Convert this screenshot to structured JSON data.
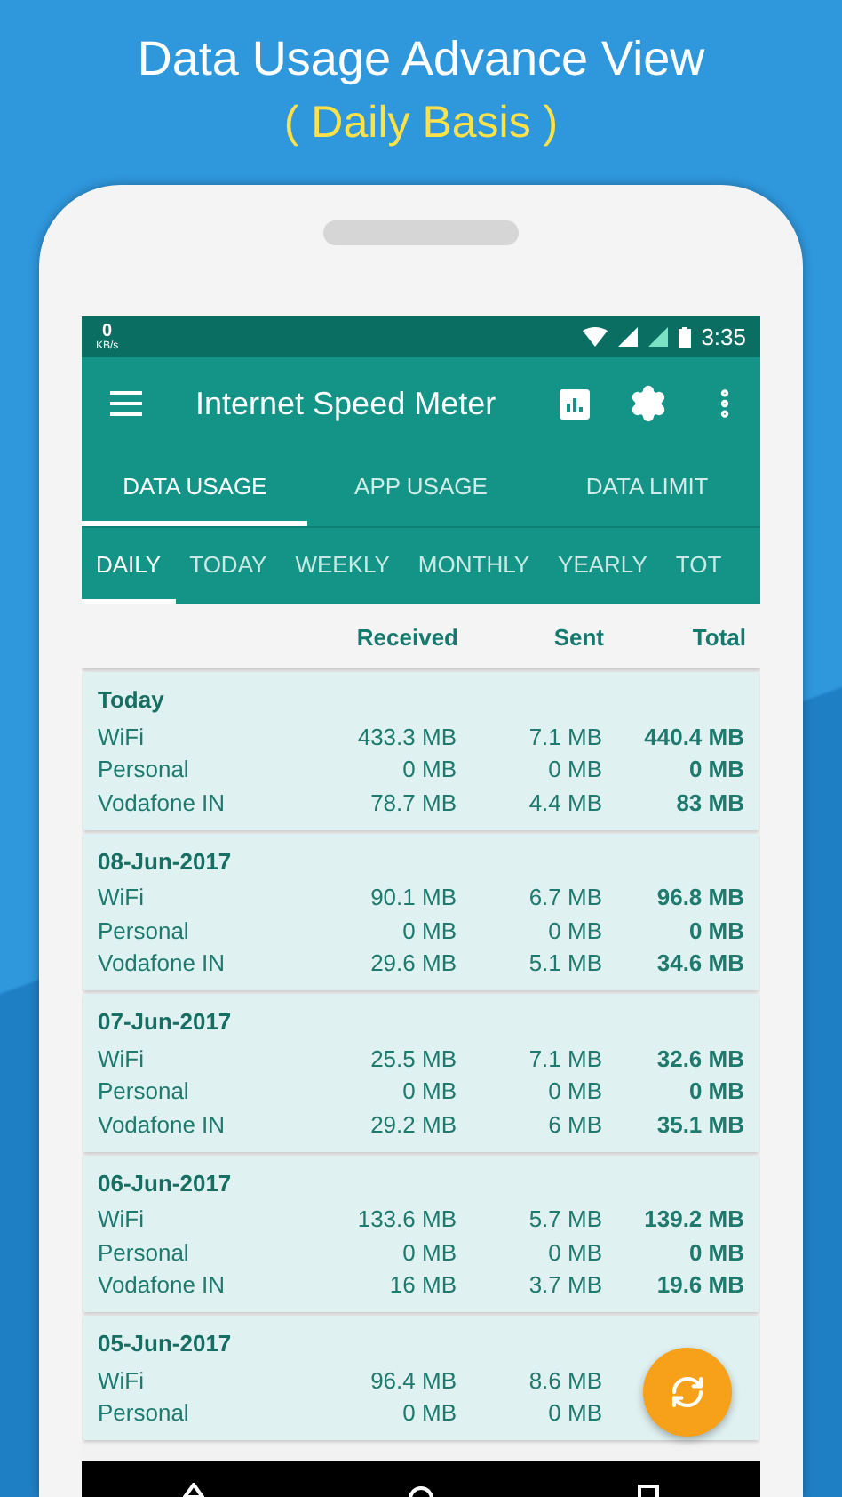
{
  "header": {
    "title": "Data Usage Advance View",
    "subtitle": "( Daily Basis )"
  },
  "status_bar": {
    "speed": "0",
    "unit": "KB/s",
    "time": "3:35"
  },
  "toolbar": {
    "title": "Internet Speed Meter"
  },
  "tabs": [
    {
      "label": "DATA USAGE",
      "selected": true
    },
    {
      "label": "APP USAGE",
      "selected": false
    },
    {
      "label": "DATA LIMIT",
      "selected": false
    }
  ],
  "period_tabs": [
    {
      "label": "DAILY",
      "selected": true
    },
    {
      "label": "TODAY",
      "selected": false
    },
    {
      "label": "WEEKLY",
      "selected": false
    },
    {
      "label": "MONTHLY",
      "selected": false
    },
    {
      "label": "YEARLY",
      "selected": false
    },
    {
      "label": "TOT",
      "selected": false
    }
  ],
  "columns": [
    "Received",
    "Sent",
    "Total"
  ],
  "days": [
    {
      "date": "Today",
      "rows": [
        {
          "network": "WiFi",
          "received": "433.3 MB",
          "sent": "7.1 MB",
          "total": "440.4 MB"
        },
        {
          "network": "Personal",
          "received": "0 MB",
          "sent": "0 MB",
          "total": "0 MB"
        },
        {
          "network": "Vodafone IN",
          "received": "78.7 MB",
          "sent": "4.4 MB",
          "total": "83 MB"
        }
      ]
    },
    {
      "date": "08-Jun-2017",
      "rows": [
        {
          "network": "WiFi",
          "received": "90.1 MB",
          "sent": "6.7 MB",
          "total": "96.8 MB"
        },
        {
          "network": "Personal",
          "received": "0 MB",
          "sent": "0 MB",
          "total": "0 MB"
        },
        {
          "network": "Vodafone IN",
          "received": "29.6 MB",
          "sent": "5.1 MB",
          "total": "34.6 MB"
        }
      ]
    },
    {
      "date": "07-Jun-2017",
      "rows": [
        {
          "network": "WiFi",
          "received": "25.5 MB",
          "sent": "7.1 MB",
          "total": "32.6 MB"
        },
        {
          "network": "Personal",
          "received": "0 MB",
          "sent": "0 MB",
          "total": "0 MB"
        },
        {
          "network": "Vodafone IN",
          "received": "29.2 MB",
          "sent": "6 MB",
          "total": "35.1 MB"
        }
      ]
    },
    {
      "date": "06-Jun-2017",
      "rows": [
        {
          "network": "WiFi",
          "received": "133.6 MB",
          "sent": "5.7 MB",
          "total": "139.2 MB"
        },
        {
          "network": "Personal",
          "received": "0 MB",
          "sent": "0 MB",
          "total": "0 MB"
        },
        {
          "network": "Vodafone IN",
          "received": "16 MB",
          "sent": "3.7 MB",
          "total": "19.6 MB"
        }
      ]
    },
    {
      "date": "05-Jun-2017",
      "rows": [
        {
          "network": "WiFi",
          "received": "96.4 MB",
          "sent": "8.6 MB"
        },
        {
          "network": "Personal",
          "received": "0 MB",
          "sent": "0 MB"
        }
      ]
    }
  ]
}
